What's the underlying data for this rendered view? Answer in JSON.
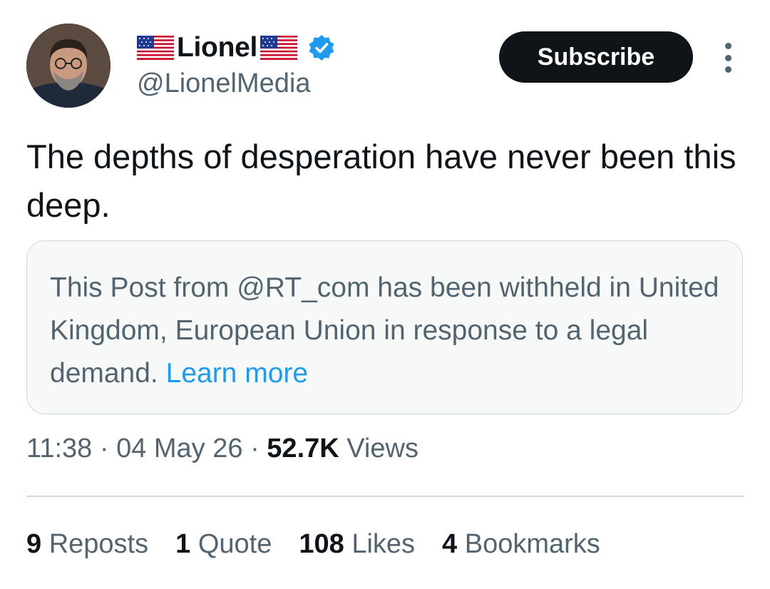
{
  "author": {
    "display_name": "Lionel",
    "handle": "@LionelMedia",
    "flag_icon": "us-flag-icon",
    "verified_icon": "verified-badge-icon",
    "verified_color": "#1d9bf0"
  },
  "actions": {
    "subscribe_label": "Subscribe",
    "more_icon": "more-vertical-icon"
  },
  "tweet": {
    "text": "The depths of desperation have never been this deep."
  },
  "withheld_notice": {
    "text": "This Post from @RT_com has been withheld in United Kingdom, European Union in response to a legal demand.",
    "link_label": "Learn more",
    "link_color": "#1d9bf0"
  },
  "meta": {
    "time": "11:38",
    "separator": "·",
    "date": "04 May 26",
    "views_count": "52.7K",
    "views_label": "Views"
  },
  "stats": {
    "reposts_count": "9",
    "reposts_label": "Reposts",
    "quote_count": "1",
    "quote_label": "Quote",
    "likes_count": "108",
    "likes_label": "Likes",
    "bookmarks_count": "4",
    "bookmarks_label": "Bookmarks"
  },
  "colors": {
    "text_primary": "#0f1419",
    "text_secondary": "#536471",
    "border": "#cfd9de"
  }
}
